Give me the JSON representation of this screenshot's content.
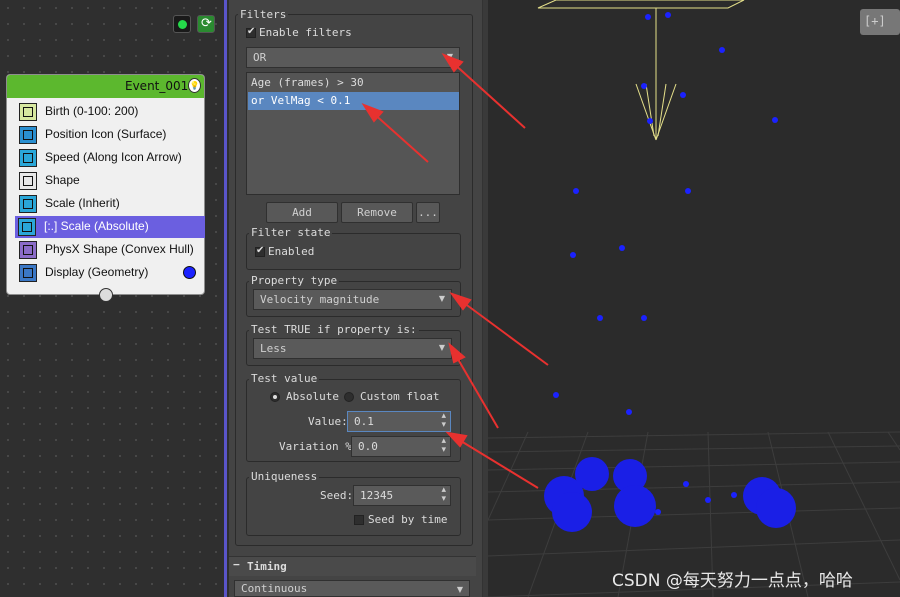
{
  "node_editor": {
    "event": {
      "title": "Event_001",
      "operators": [
        {
          "label": "Birth (0-100: 200)",
          "icon": "birth-icon"
        },
        {
          "label": "Position Icon (Surface)",
          "icon": "position-icon"
        },
        {
          "label": "Speed (Along Icon Arrow)",
          "icon": "speed-icon"
        },
        {
          "label": "Shape",
          "icon": "shape-icon"
        },
        {
          "label": "Scale (Inherit)",
          "icon": "scale-icon"
        },
        {
          "label": "[:.] Scale (Absolute)",
          "icon": "scale-icon"
        },
        {
          "label": "PhysX Shape (Convex Hull)",
          "icon": "physx-icon"
        },
        {
          "label": "Display (Geometry)",
          "icon": "display-icon"
        }
      ],
      "selected_index": 5
    }
  },
  "panel": {
    "filters": {
      "title": "Filters",
      "enable_label": "Enable filters",
      "enabled": true,
      "combine_mode": "OR",
      "items": [
        "Age (frames) > 30",
        "or VelMag < 0.1"
      ],
      "selected_index": 1,
      "add_label": "Add",
      "remove_label": "Remove",
      "more_label": "..."
    },
    "filter_state": {
      "title": "Filter state",
      "enabled_label": "Enabled",
      "enabled": true
    },
    "property_type": {
      "title": "Property type",
      "value": "Velocity magnitude"
    },
    "test_true": {
      "title": "Test TRUE if property is:",
      "value": "Less"
    },
    "test_value": {
      "title": "Test value",
      "absolute_label": "Absolute",
      "custom_label": "Custom float",
      "mode": "Absolute",
      "value_label": "Value:",
      "value": "0.1",
      "variation_label": "Variation %:",
      "variation": "0.0"
    },
    "uniqueness": {
      "title": "Uniqueness",
      "seed_label": "Seed:",
      "seed": "12345",
      "seed_by_time_label": "Seed by time",
      "seed_by_time": false
    },
    "timing": {
      "title": "Timing",
      "mode": "Continuous"
    }
  },
  "viewport": {
    "label": "[+]"
  },
  "watermark": "CSDN @每天努力一点点，哈哈",
  "colors": {
    "node_header": "#5cb82e",
    "selection": "#6b5fe0",
    "list_selection": "#5a87c0",
    "annotation_arrow": "#e8312f",
    "particle": "#1b22ff"
  }
}
